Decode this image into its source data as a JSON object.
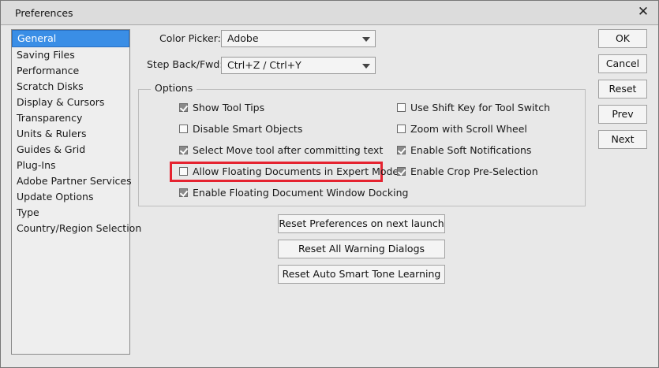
{
  "window": {
    "title": "Preferences",
    "close_glyph": "✕"
  },
  "sidebar": {
    "items": [
      {
        "label": "General",
        "selected": true
      },
      {
        "label": "Saving Files"
      },
      {
        "label": "Performance"
      },
      {
        "label": "Scratch Disks"
      },
      {
        "label": "Display & Cursors"
      },
      {
        "label": "Transparency"
      },
      {
        "label": "Units & Rulers"
      },
      {
        "label": "Guides & Grid"
      },
      {
        "label": "Plug-Ins"
      },
      {
        "label": "Adobe Partner Services"
      },
      {
        "label": "Update Options"
      },
      {
        "label": "Type"
      },
      {
        "label": "Country/Region Selection"
      }
    ]
  },
  "general": {
    "color_picker_label": "Color Picker:",
    "color_picker_value": "Adobe",
    "step_label": "Step Back/Fwd:",
    "step_value": "Ctrl+Z / Ctrl+Y",
    "options_title": "Options"
  },
  "options": {
    "show_tool_tips": {
      "label": "Show Tool Tips",
      "checked": true
    },
    "disable_smart_objects": {
      "label": "Disable Smart Objects",
      "checked": false
    },
    "select_move_tool": {
      "label": "Select Move tool after committing text",
      "checked": true
    },
    "allow_floating_docs": {
      "label": "Allow Floating Documents in Expert Mode",
      "checked": false,
      "highlighted": true
    },
    "enable_floating_docking": {
      "label": "Enable Floating Document Window Docking",
      "checked": true
    },
    "use_shift_key": {
      "label": "Use Shift Key for Tool Switch",
      "checked": false
    },
    "zoom_scroll": {
      "label": "Zoom with Scroll Wheel",
      "checked": false
    },
    "soft_notifications": {
      "label": "Enable Soft Notifications",
      "checked": true
    },
    "crop_preselection": {
      "label": "Enable Crop Pre-Selection",
      "checked": true
    }
  },
  "actions": {
    "reset_prefs": "Reset Preferences on next launch",
    "reset_warnings": "Reset All Warning Dialogs",
    "reset_smart_tone": "Reset Auto Smart Tone Learning"
  },
  "buttons": {
    "ok": "OK",
    "cancel": "Cancel",
    "reset": "Reset",
    "prev": "Prev",
    "next": "Next"
  },
  "colors": {
    "highlight": "#e52330",
    "selection": "#3a8ee6"
  }
}
